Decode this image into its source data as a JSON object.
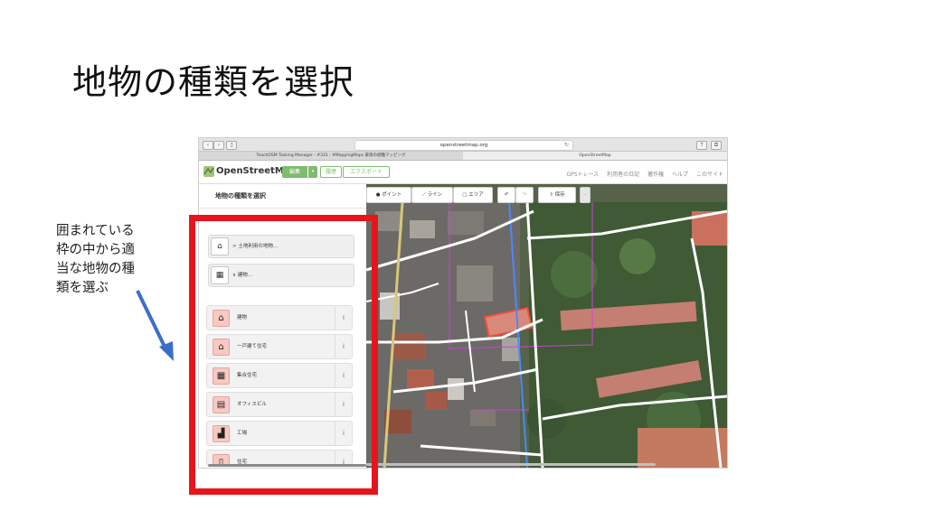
{
  "slide": {
    "title": "地物の種類を選択",
    "callout_lines": [
      "囲まれている",
      "枠の中から適",
      "当な地物の種",
      "類を選ぶ"
    ]
  },
  "browser": {
    "url": "openstreetmap.org",
    "tabs": [
      "TeachOSM Tasking Manager - #331 : #MappingMaps 豪雨の避難マッピング",
      "OpenStreetMap"
    ]
  },
  "osm": {
    "logo_text": "OpenStreetMap",
    "edit_label": "編集",
    "history_label": "履歴",
    "export_label": "エクスポート",
    "top_links": [
      "GPSトレース",
      "利用者の日記",
      "著作権",
      "ヘルプ",
      "このサイト"
    ]
  },
  "sidebar": {
    "title": "地物の種類を選択",
    "categories": [
      {
        "label": "> 土地利用の地物...",
        "icon": "landuse-icon"
      },
      {
        "label": "∨ 建物...",
        "icon": "building-icon"
      }
    ],
    "presets": [
      {
        "label": "建物",
        "icon": "house-icon"
      },
      {
        "label": "一戸建て住宅",
        "icon": "house-icon"
      },
      {
        "label": "集合住宅",
        "icon": "apartment-icon"
      },
      {
        "label": "オフィスビル",
        "icon": "office-icon"
      },
      {
        "label": "工場",
        "icon": "factory-icon"
      },
      {
        "label": "住宅",
        "icon": "residential-icon"
      }
    ],
    "info_glyph": "i"
  },
  "toolbar": {
    "point_label": "ポイント",
    "line_label": "ライン",
    "area_label": "エリア",
    "save_label": "保存"
  },
  "colors": {
    "highlight": "#e8141c",
    "arrow": "#3a6fc8",
    "osm_green": "#7ebc6f",
    "preset_icon_bg": "#f8c8c3"
  }
}
